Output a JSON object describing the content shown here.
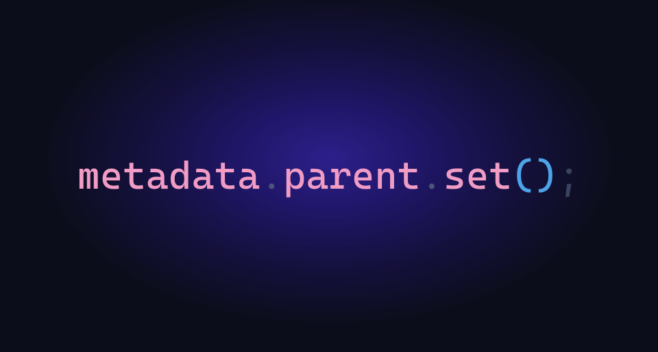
{
  "code": {
    "token1": "metadata",
    "dot1": ".",
    "token2": "parent",
    "dot2": ".",
    "token3": "set",
    "paren_open": "(",
    "paren_close": ")",
    "semicolon": ";"
  }
}
